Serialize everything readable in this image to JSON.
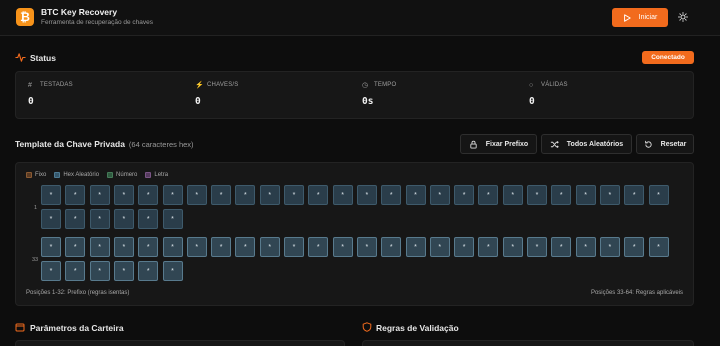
{
  "header": {
    "title": "BTC Key Recovery",
    "subtitle": "Ferramenta de recuperação de chaves",
    "logo_glyph": "₿",
    "start_label": "Iniciar",
    "accent": "#f26b1d",
    "logo_color": "#f7931a"
  },
  "status": {
    "title": "Status",
    "badge": "Conectado",
    "stats": [
      {
        "icon": "hash-icon",
        "label": "TESTADAS",
        "value": "0"
      },
      {
        "icon": "bolt-icon",
        "label": "CHAVES/S",
        "value": "0"
      },
      {
        "icon": "clock-icon",
        "label": "TEMPO",
        "value": "0s"
      },
      {
        "icon": "search-icon",
        "label": "VÁLIDAS",
        "value": "0"
      }
    ]
  },
  "template": {
    "title": "Template da Chave Privada",
    "subtitle": "(64 caracteres hex)",
    "buttons": {
      "fix_prefix": "Fixar Prefixo",
      "all_random": "Todos Aleatórios",
      "reset": "Resetar"
    },
    "legend": [
      {
        "label": "Fixo",
        "color": "#5a3a22"
      },
      {
        "label": "Hex Aleatório",
        "color": "#35586d"
      },
      {
        "label": "Número",
        "color": "#2f5a3f"
      },
      {
        "label": "Letra",
        "color": "#553a5e"
      }
    ],
    "row1_label": "1",
    "row2_label": "33",
    "cell_glyph": "*",
    "footer_left": "Posições 1-32: Prefixo (regras isentas)",
    "footer_right": "Posições 33-64: Regras aplicáveis"
  },
  "sections": {
    "wallet_params": "Parâmetros da Carteira",
    "validation_rules": "Regras de Validação"
  }
}
